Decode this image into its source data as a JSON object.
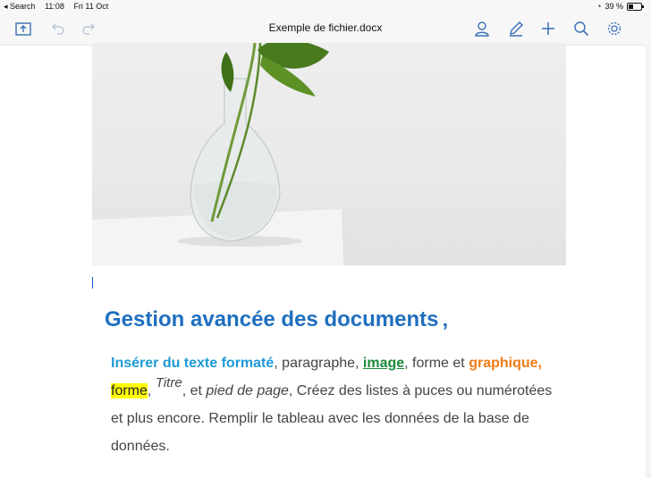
{
  "status": {
    "back_label": "◂ Search",
    "time": "11:08",
    "date": "Fri 11 Oct",
    "battery": "39 %"
  },
  "toolbar": {
    "title": "Exemple de fichier.docx",
    "icons": [
      "upload-icon",
      "undo-icon",
      "redo-icon",
      "user-icon",
      "pen-icon",
      "plus-icon",
      "search-icon",
      "gear-icon"
    ]
  },
  "document": {
    "heading": "Gestion avancée des documents",
    "heading_mark": "‚",
    "p1": {
      "formatted": "Insérer du texte formaté",
      "after_formatted": ",  paragraphe, ",
      "image": "image",
      "after_image": ", forme et ",
      "graphique": "graphique",
      "comma": ","
    },
    "p2": {
      "forme": "forme",
      "comma": ",",
      "titre": "Titre",
      "et": ", et ",
      "pied": "pied de page",
      "rest": ", Créez des listes à puces ou numérotées"
    },
    "line3": "et plus encore. Remplir le tableau avec les données de la base de",
    "line4": "données."
  }
}
